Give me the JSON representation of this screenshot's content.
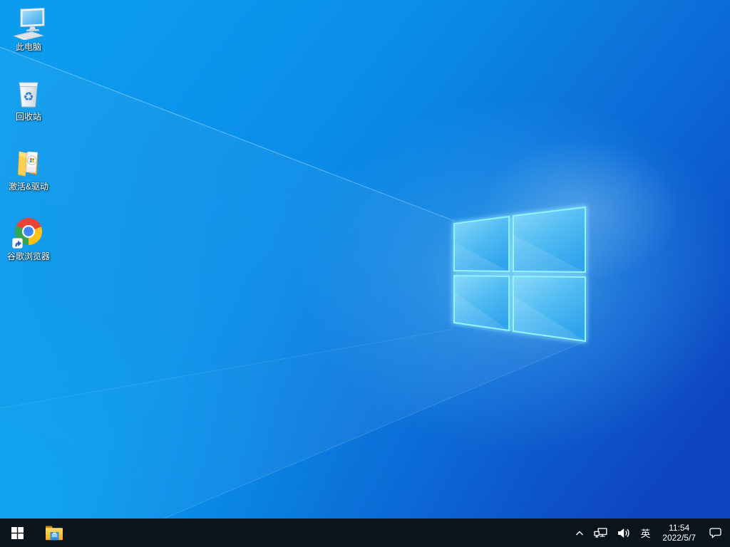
{
  "desktop": {
    "icons": [
      {
        "name": "this-pc",
        "icon": "computer-icon",
        "label": "此电脑"
      },
      {
        "name": "recycle-bin",
        "icon": "recycle-bin-icon",
        "label": "回收站"
      },
      {
        "name": "activation-drivers",
        "icon": "open-folder-icon",
        "label": "激活&驱动"
      },
      {
        "name": "google-chrome",
        "icon": "chrome-icon",
        "label": "谷歌浏览器"
      }
    ],
    "wallpaper": {
      "name": "windows10-light-blue",
      "left_color": "#0c9cee",
      "right_color": "#0e45c1",
      "logo_border_color": "#8df3ff"
    }
  },
  "taskbar": {
    "background_color": "#0b141c",
    "start_button": {
      "icon": "windows-logo-icon"
    },
    "pinned": [
      {
        "name": "file-explorer",
        "icon": "file-explorer-icon"
      }
    ],
    "tray": {
      "hidden_icons": {
        "icon": "chevron-up-icon"
      },
      "network": {
        "icon": "network-icon"
      },
      "volume": {
        "icon": "speaker-icon"
      },
      "language": "英",
      "clock": {
        "time": "11:54",
        "date": "2022/5/7"
      },
      "action_center": {
        "icon": "action-center-icon"
      }
    }
  }
}
